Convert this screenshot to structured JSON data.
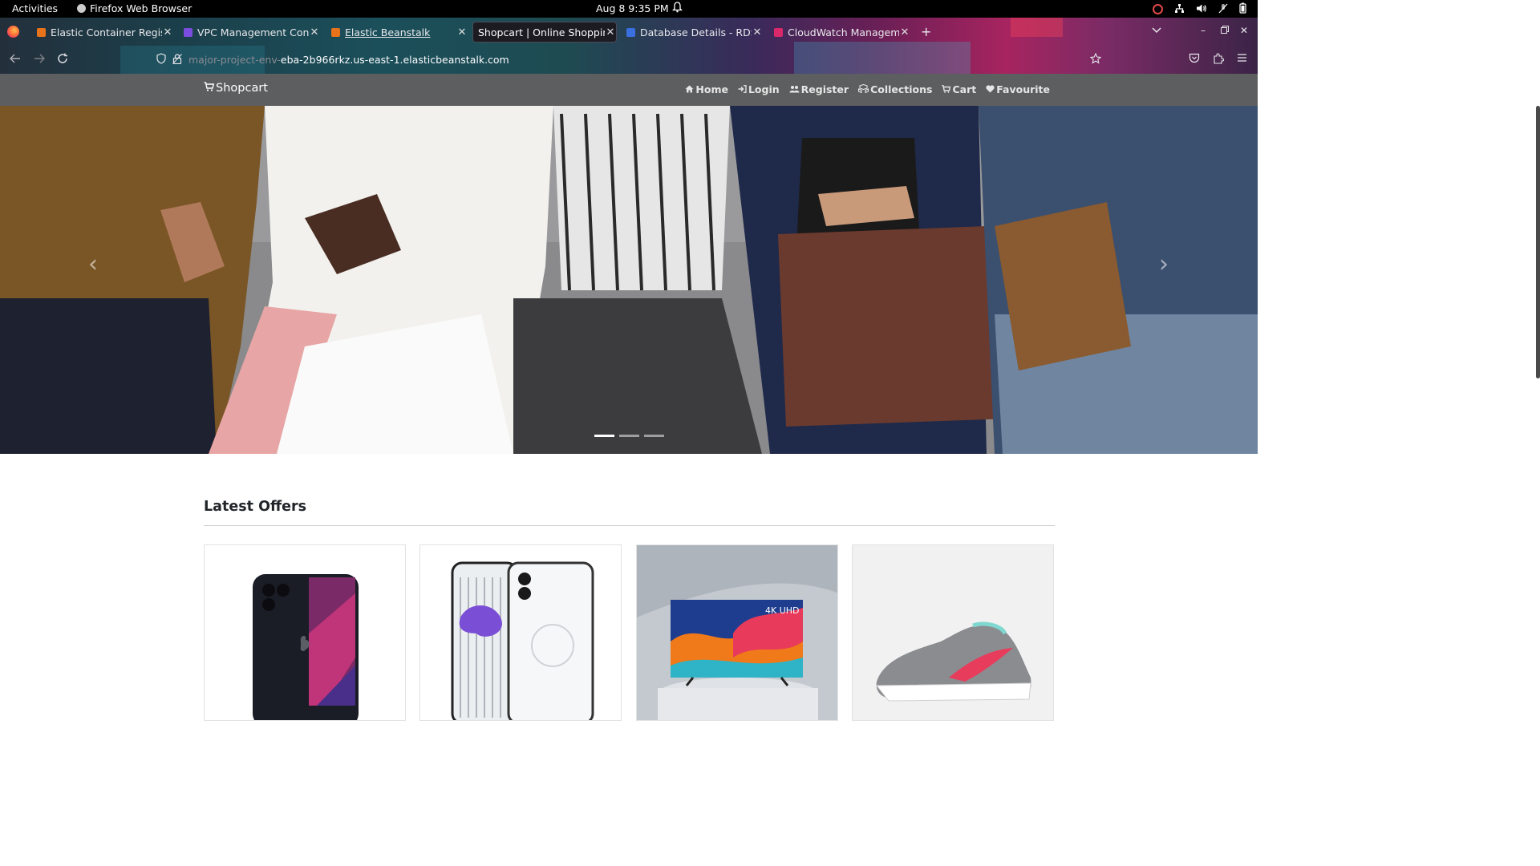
{
  "system": {
    "activities": "Activities",
    "app_name": "Firefox Web Browser",
    "clock": "Aug 8  9:35 PM"
  },
  "browser": {
    "tabs": [
      {
        "title": "Elastic Container Regist",
        "favicon_color": "#e8731a",
        "active": false
      },
      {
        "title": "VPC Management Conso",
        "favicon_color": "#7b4ce0",
        "active": false
      },
      {
        "title": "Elastic Beanstalk",
        "favicon_color": "#e8731a",
        "active": false
      },
      {
        "title": "Shopcart | Online Shopping",
        "favicon_color": "",
        "active": true
      },
      {
        "title": "Database Details - RDS M",
        "favicon_color": "#3a6fe0",
        "active": false
      },
      {
        "title": "CloudWatch Managemen",
        "favicon_color": "#d9296a",
        "active": false
      }
    ],
    "url_prefix": "major-project-env-",
    "url_main": "eba-2b966rkz.us-east-1.elasticbeanstalk.com"
  },
  "site": {
    "brand": "Shopcart",
    "nav": [
      {
        "label": "Home",
        "icon": "home-icon"
      },
      {
        "label": "Login",
        "icon": "login-icon"
      },
      {
        "label": "Register",
        "icon": "register-icon"
      },
      {
        "label": "Collections",
        "icon": "collections-icon"
      },
      {
        "label": "Cart",
        "icon": "cart-icon"
      },
      {
        "label": "Favourite",
        "icon": "heart-icon"
      }
    ],
    "carousel": {
      "slides": 3,
      "active_slide": 1
    },
    "offers_title": "Latest Offers",
    "products": [
      {
        "image": "iphone"
      },
      {
        "image": "nothing-phone"
      },
      {
        "image": "television",
        "badge": "4K UHD"
      },
      {
        "image": "sneaker"
      }
    ]
  },
  "colors": {
    "navbar_bg": "#5d5e5f",
    "top_bar_bg": "#000000"
  }
}
